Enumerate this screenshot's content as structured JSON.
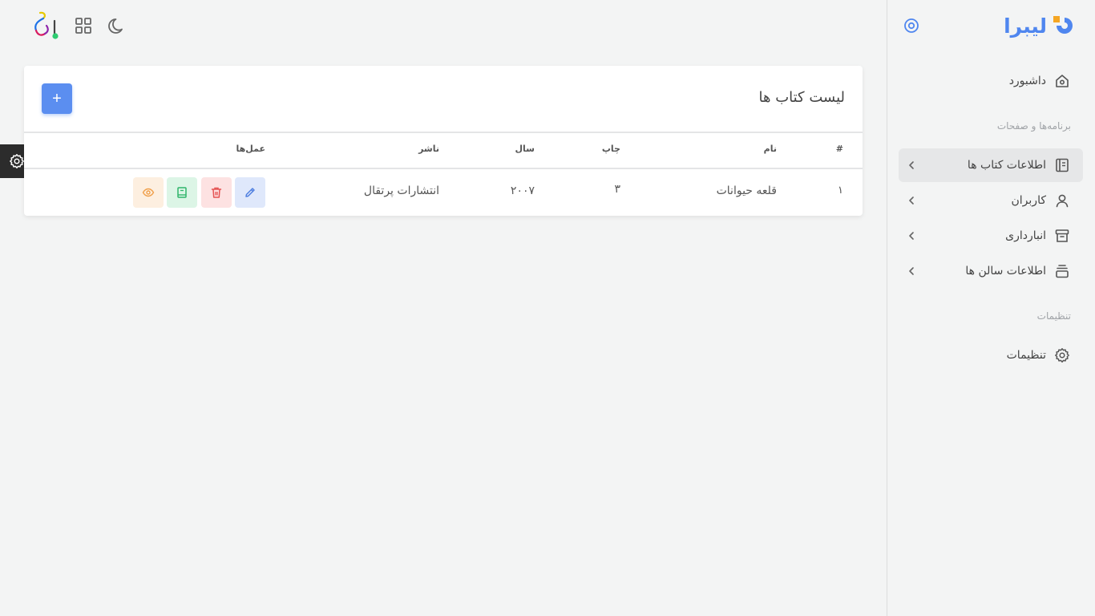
{
  "brand": {
    "name": "لیبرا"
  },
  "sidebar": {
    "dashboard": "داشبورد",
    "section_apps": "برنامه‌ها و صفحات",
    "items": [
      {
        "label": "اطلاعات کتاب ها",
        "active": true
      },
      {
        "label": "کاربران"
      },
      {
        "label": "انبارداری"
      },
      {
        "label": "اطلاعات سالن ها"
      }
    ],
    "section_settings": "تنظیمات",
    "settings": "تنظیمات"
  },
  "card": {
    "title": "لیست کتاب ها",
    "add_label": "+",
    "columns": [
      "#",
      "نام",
      "چاپ",
      "سال",
      "ناشر",
      "عمل‌ها"
    ],
    "rows": [
      {
        "index": "۱",
        "name": "قلعه حیوانات",
        "print": "۳",
        "year": "۲۰۰۷",
        "publisher": "انتشارات پرتقال"
      }
    ]
  },
  "colors": {
    "brand": "#4f86ef",
    "primary": "#5b8ef0",
    "edit_bg": "#dfe8fb",
    "delete_bg": "#fde2e2",
    "book_bg": "#dcf5e6",
    "view_bg": "#fdefe0"
  },
  "icons": [
    "collapse-icon",
    "home-icon",
    "book-icon",
    "user-icon",
    "archive-icon",
    "hall-icon",
    "gear-icon",
    "moon-icon",
    "grid-icon",
    "avatar-icon",
    "edit-icon",
    "trash-icon",
    "notebook-icon",
    "eye-icon"
  ]
}
